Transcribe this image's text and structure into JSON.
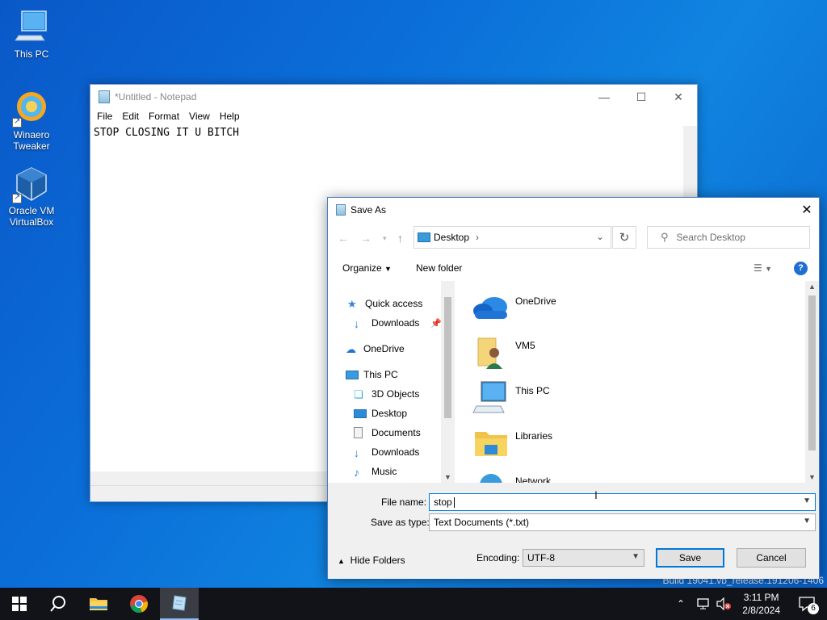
{
  "desktop": {
    "icons": [
      {
        "label": "This PC",
        "icon": "computer-icon"
      },
      {
        "label": "Winaero Tweaker",
        "icon": "winaero-tweaker-icon"
      },
      {
        "label": "Oracle VM VirtualBox",
        "icon": "virtualbox-icon"
      }
    ],
    "watermark": "Build 19041.vb_release.191206-1406"
  },
  "notepad": {
    "title": "*Untitled - Notepad",
    "menu": [
      "File",
      "Edit",
      "Format",
      "View",
      "Help"
    ],
    "content": "STOP CLOSING IT U BITCH"
  },
  "save_dialog": {
    "title": "Save As",
    "address": "Desktop",
    "search_placeholder": "Search Desktop",
    "toolbar": {
      "organize": "Organize",
      "new_folder": "New folder"
    },
    "nav_items": [
      {
        "label": "Quick access",
        "icon": "star-icon"
      },
      {
        "label": "Downloads",
        "icon": "download-arrow-icon"
      },
      {
        "label": "OneDrive",
        "icon": "cloud-icon"
      },
      {
        "label": "This PC",
        "icon": "computer-icon"
      },
      {
        "label": "3D Objects",
        "icon": "cube-icon"
      },
      {
        "label": "Desktop",
        "icon": "desktop-icon"
      },
      {
        "label": "Documents",
        "icon": "document-icon"
      },
      {
        "label": "Downloads",
        "icon": "download-arrow-icon"
      },
      {
        "label": "Music",
        "icon": "music-note-icon"
      }
    ],
    "files": [
      {
        "label": "OneDrive",
        "icon": "cloud-icon"
      },
      {
        "label": "VM5",
        "icon": "user-folder-icon"
      },
      {
        "label": "This PC",
        "icon": "computer-icon"
      },
      {
        "label": "Libraries",
        "icon": "library-folder-icon"
      },
      {
        "label": "Network",
        "icon": "network-icon"
      }
    ],
    "file_name_label": "File name:",
    "file_name_value": "stop",
    "save_type_label": "Save as type:",
    "save_type_value": "Text Documents (*.txt)",
    "hide_folders": "Hide Folders",
    "encoding_label": "Encoding:",
    "encoding_value": "UTF-8",
    "save_button": "Save",
    "cancel_button": "Cancel"
  },
  "taskbar": {
    "time": "3:11 PM",
    "date": "2/8/2024",
    "notification_count": "6"
  },
  "colors": {
    "accent": "#0078d7",
    "taskbar": "#111318",
    "desktop": "#0b6fd9"
  }
}
